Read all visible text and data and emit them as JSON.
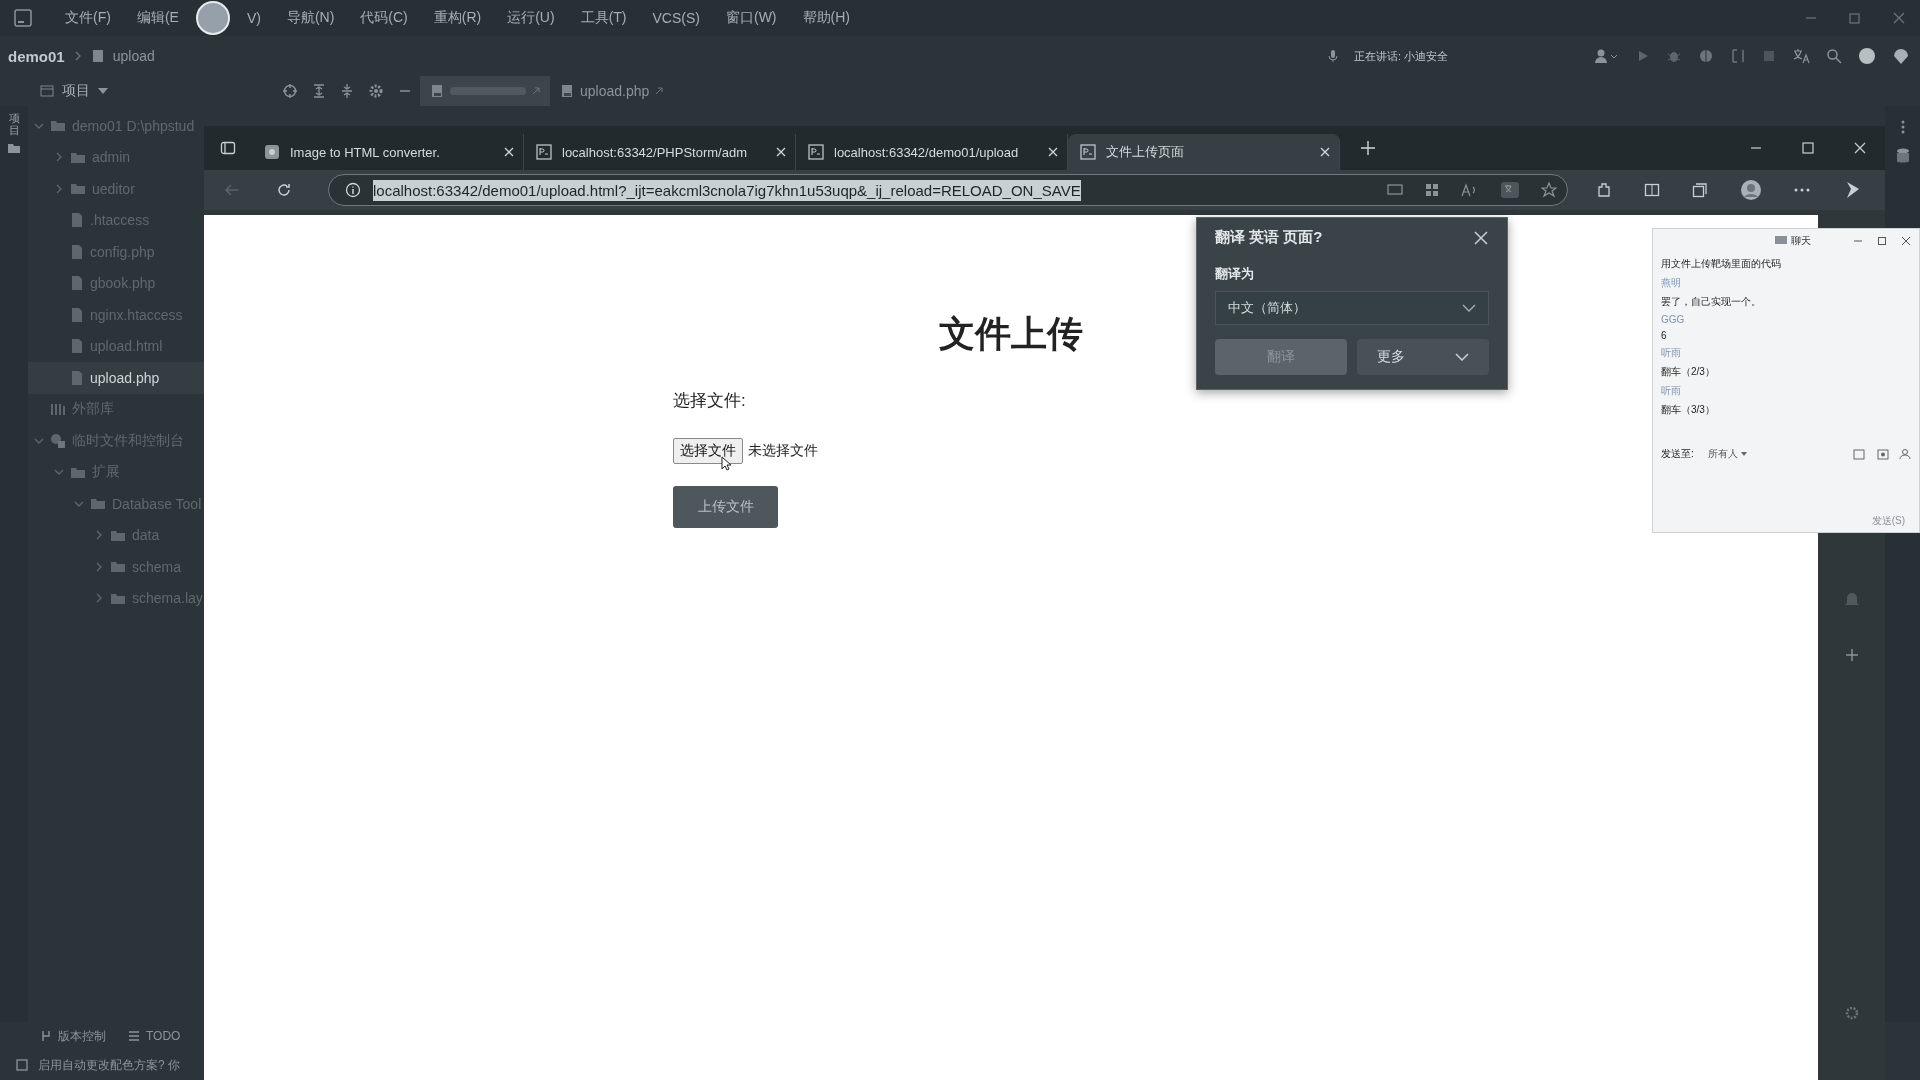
{
  "ide": {
    "menu": [
      "文件(F)",
      "编辑(E",
      "V)",
      "导航(N)",
      "代码(C)",
      "重构(R)",
      "运行(U)",
      "工具(T)",
      "VCS(S)",
      "窗口(W)",
      "帮助(H)"
    ],
    "breadcrumb": [
      "demo01",
      "upload"
    ],
    "speaking": "正在讲话: 小迪安全",
    "project_label": "项目",
    "side_label": "项目",
    "editor_tabs": [
      {
        "selected": true
      },
      {
        "label": "upload.php",
        "selected": false
      }
    ],
    "tree": [
      {
        "label": "demo01  D:\\phpstud",
        "kind": "folder",
        "expanded": true,
        "selected": false,
        "children": [
          {
            "label": "admin",
            "kind": "folder",
            "expanded": false,
            "selected": false
          },
          {
            "label": "ueditor",
            "kind": "folder",
            "expanded": false,
            "selected": false
          },
          {
            "label": ".htaccess",
            "kind": "file",
            "selected": false
          },
          {
            "label": "config.php",
            "kind": "file",
            "selected": false
          },
          {
            "label": "gbook.php",
            "kind": "file",
            "selected": false
          },
          {
            "label": "nginx.htaccess",
            "kind": "file",
            "selected": false
          },
          {
            "label": "upload.html",
            "kind": "file",
            "selected": false
          },
          {
            "label": "upload.php",
            "kind": "file",
            "selected": true
          }
        ]
      },
      {
        "label": "外部库",
        "kind": "library",
        "selected": false
      },
      {
        "label": "临时文件和控制台",
        "kind": "scratch",
        "expanded": true,
        "selected": false,
        "children": [
          {
            "label": "扩展",
            "kind": "folder",
            "expanded": true,
            "selected": false,
            "children": [
              {
                "label": "Database Tool",
                "kind": "folder",
                "expanded": true,
                "selected": false,
                "children": [
                  {
                    "label": "data",
                    "kind": "folder",
                    "expanded": false,
                    "selected": false
                  },
                  {
                    "label": "schema",
                    "kind": "folder",
                    "expanded": false,
                    "selected": false
                  },
                  {
                    "label": "schema.lay",
                    "kind": "folder",
                    "expanded": false,
                    "selected": false
                  }
                ]
              }
            ]
          }
        ]
      }
    ],
    "bottom_tools": [
      "版本控制",
      "TODO"
    ],
    "status": "启用自动更改配色方案? 你"
  },
  "browser": {
    "tabs": [
      {
        "label": "Image to HTML converter.",
        "kind": "web",
        "selected": false
      },
      {
        "label": "localhost:63342/PHPStorm/adm",
        "kind": "ps",
        "selected": false
      },
      {
        "label": "localhost:63342/demo01/upload",
        "kind": "ps",
        "selected": false
      },
      {
        "label": "文件上传页面",
        "kind": "ps",
        "selected": true
      }
    ],
    "url": "localhost:63342/demo01/upload.html?_ijt=eakcml3cnola7ig7khn1u53uqp&_ij_reload=RELOAD_ON_SAVE",
    "page": {
      "heading": "文件上传",
      "label": "选择文件:",
      "file_button": "选择文件",
      "file_status": "未选择文件",
      "submit": "上传文件"
    },
    "translate": {
      "title": "翻译 英语 页面?",
      "label": "翻译为",
      "language": "中文（简体）",
      "primary": "翻译",
      "more": "更多"
    }
  },
  "chat": {
    "title": "聊天",
    "messages": [
      {
        "kind": "text",
        "text": "用文件上传靶场里面的代码"
      },
      {
        "kind": "name",
        "text": "燕明"
      },
      {
        "kind": "text",
        "text": "罢了，自己实现一个。"
      },
      {
        "kind": "name",
        "text": "GGG"
      },
      {
        "kind": "text",
        "text": "6"
      },
      {
        "kind": "name",
        "text": "听雨"
      },
      {
        "kind": "text",
        "text": "翻车（2/3）"
      },
      {
        "kind": "name",
        "text": "听雨"
      },
      {
        "kind": "text",
        "text": "翻车（3/3）"
      }
    ],
    "send_to_label": "发送至:",
    "send_to": "所有人",
    "send": "发送(S)"
  }
}
